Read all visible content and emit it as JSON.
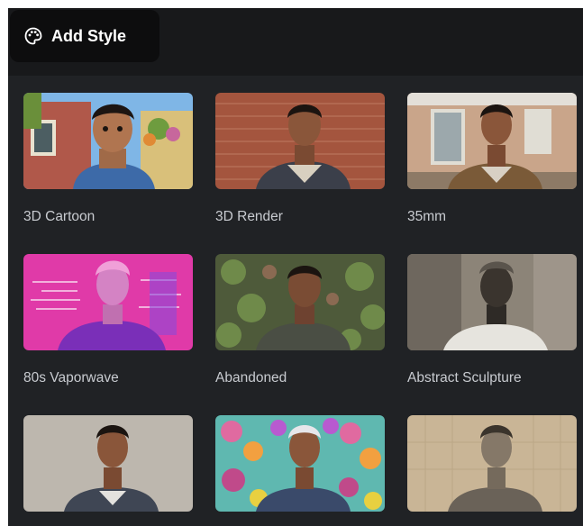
{
  "toolbar": {
    "add_style_label": "Add Style",
    "icon": "palette-icon"
  },
  "styles": [
    {
      "label": "3D Cartoon"
    },
    {
      "label": "3D Render"
    },
    {
      "label": "35mm"
    },
    {
      "label": "80s Vaporwave"
    },
    {
      "label": "Abandoned"
    },
    {
      "label": "Abstract Sculpture"
    },
    {
      "label": ""
    },
    {
      "label": ""
    },
    {
      "label": ""
    }
  ],
  "colors": {
    "panel_bg": "#202225",
    "topbar_bg": "#18191b",
    "button_bg": "#0d0d0e",
    "label_text": "#c8cbd0"
  }
}
